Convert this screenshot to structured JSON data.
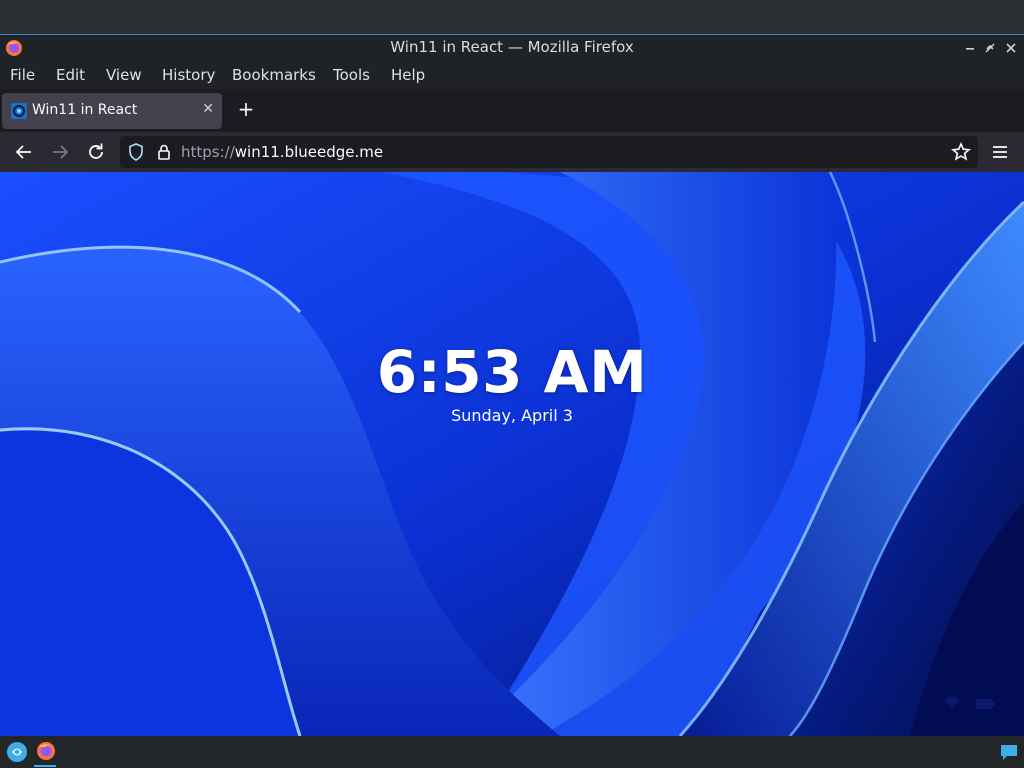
{
  "window": {
    "title": "Win11 in React — Mozilla Firefox"
  },
  "menu": {
    "items": [
      {
        "label": "File"
      },
      {
        "label": "Edit"
      },
      {
        "label": "View"
      },
      {
        "label": "History"
      },
      {
        "label": "Bookmarks"
      },
      {
        "label": "Tools"
      },
      {
        "label": "Help"
      }
    ]
  },
  "tab": {
    "label": "Win11 in React",
    "favicon": "win11-react-icon"
  },
  "url": {
    "protocol": "https://",
    "host": "win11.blueedge.me"
  },
  "lockscreen": {
    "time": "6:53 AM",
    "date": "Sunday, April 3"
  },
  "icons": [
    "firefox-icon",
    "minimize-icon",
    "restore-icon",
    "close-icon",
    "tab-close-icon",
    "plus-icon",
    "back-arrow-icon",
    "forward-arrow-icon",
    "reload-icon",
    "shield-icon",
    "lock-icon",
    "star-icon",
    "hamburger-menu-icon",
    "wifi-icon",
    "battery-icon",
    "kde-launcher-icon",
    "chat-icon"
  ],
  "colors": {
    "accent": "#3daee9",
    "wallpaper_blue": "#0a36d6"
  }
}
